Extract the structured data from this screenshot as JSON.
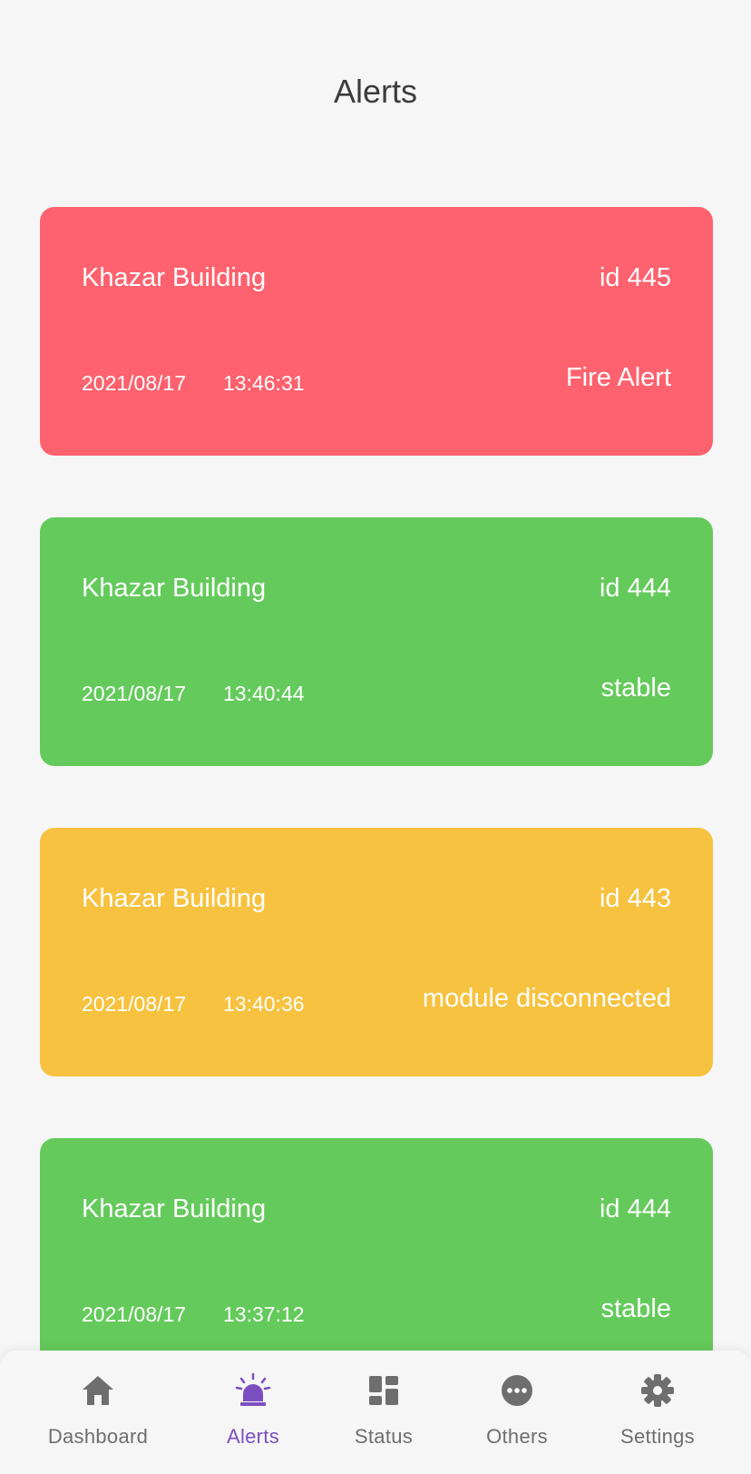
{
  "header": {
    "title": "Alerts"
  },
  "alerts": [
    {
      "building": "Khazar Building",
      "id": "id 445",
      "date": "2021/08/17",
      "time": "13:46:31",
      "status": "Fire Alert",
      "color": "#fd626e"
    },
    {
      "building": "Khazar Building",
      "id": "id 444",
      "date": "2021/08/17",
      "time": "13:40:44",
      "status": "stable",
      "color": "#65ca5c"
    },
    {
      "building": "Khazar Building",
      "id": "id 443",
      "date": "2021/08/17",
      "time": "13:40:36",
      "status": "module disconnected",
      "color": "#f7c240"
    },
    {
      "building": "Khazar Building",
      "id": "id 444",
      "date": "2021/08/17",
      "time": "13:37:12",
      "status": "stable",
      "color": "#65ca5c"
    }
  ],
  "nav": {
    "items": [
      {
        "label": "Dashboard",
        "icon": "home-icon"
      },
      {
        "label": "Alerts",
        "icon": "siren-icon"
      },
      {
        "label": "Status",
        "icon": "dashboard-grid-icon"
      },
      {
        "label": "Others",
        "icon": "more-horizontal-icon"
      },
      {
        "label": "Settings",
        "icon": "gear-icon"
      }
    ],
    "active": "Alerts",
    "active_color": "#7b4fbf",
    "inactive_color": "#6e6e6e"
  }
}
